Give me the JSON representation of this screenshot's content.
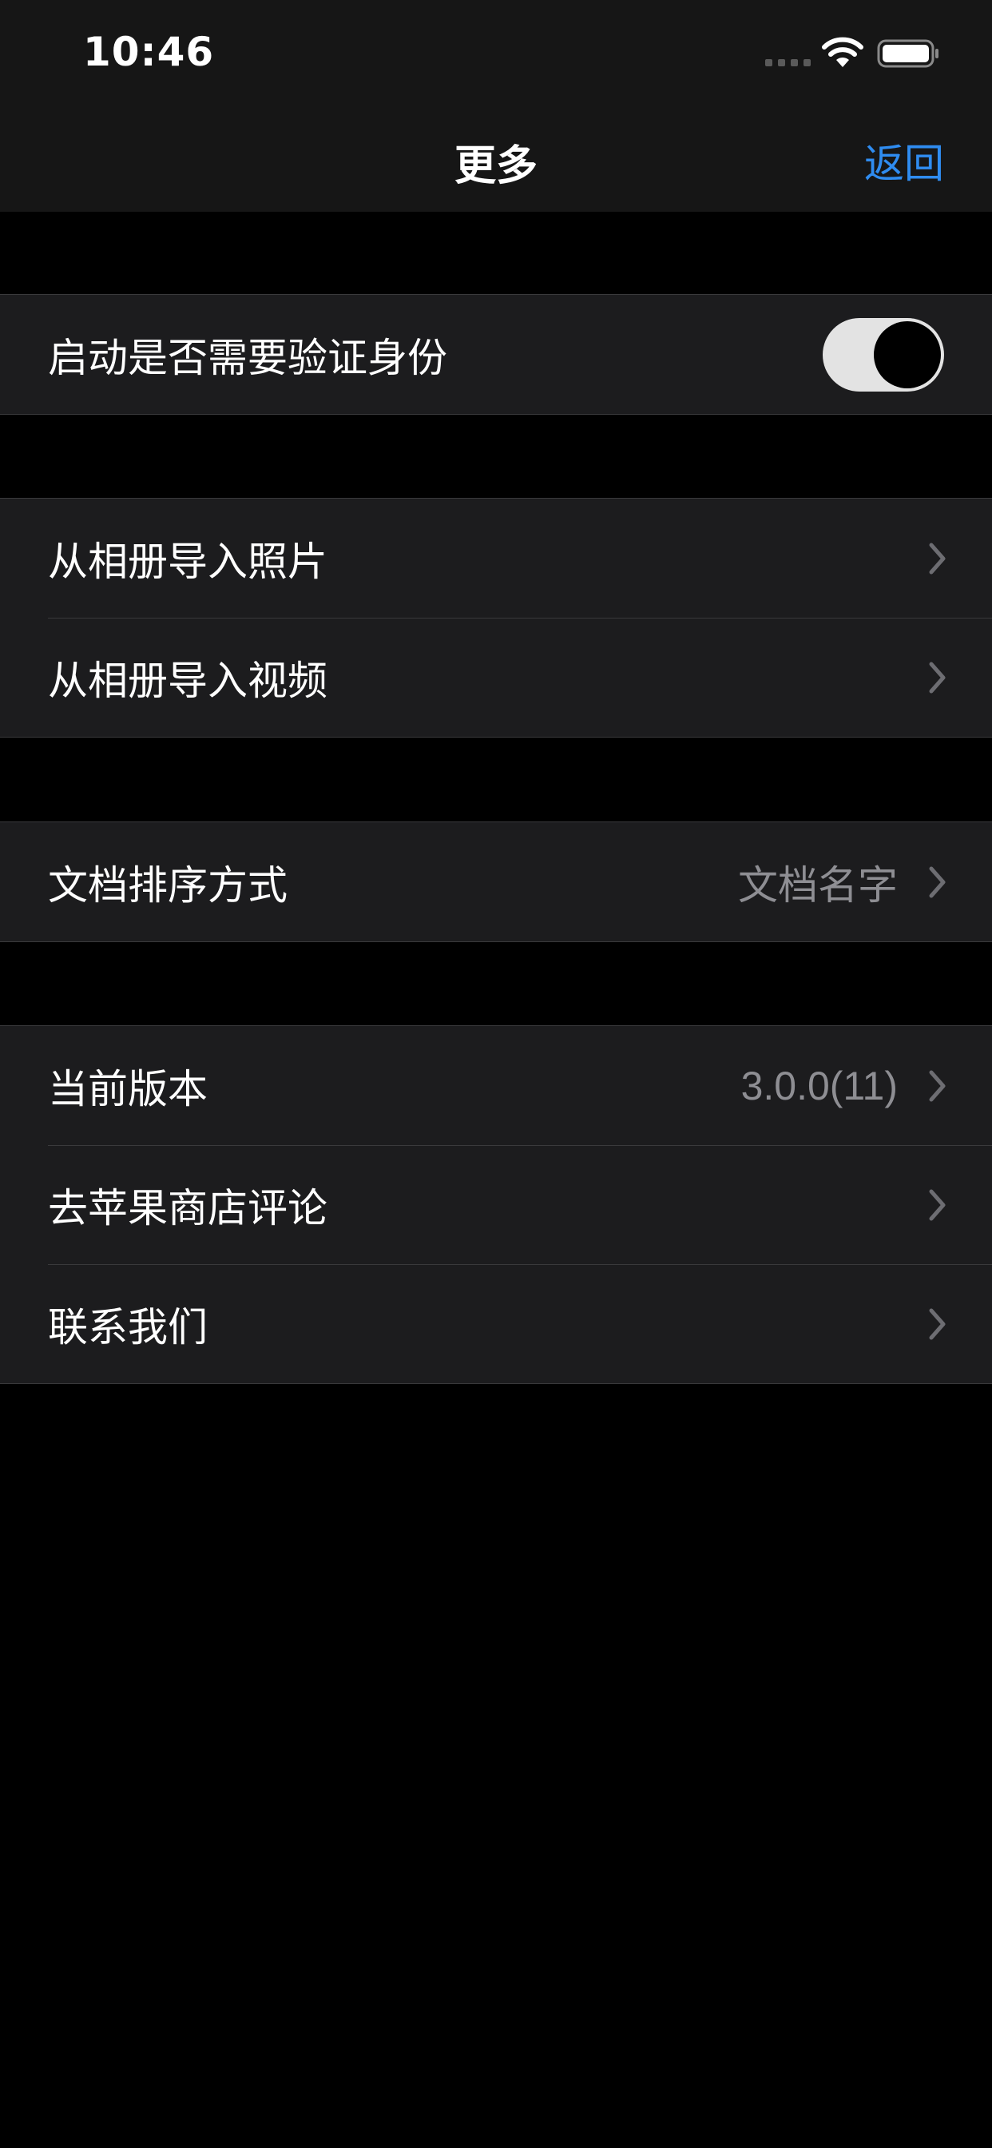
{
  "status_bar": {
    "time": "10:46",
    "icons": [
      "cellular-signal-icon",
      "wifi-icon",
      "battery-icon"
    ]
  },
  "nav": {
    "title": "更多",
    "back_label": "返回"
  },
  "colors": {
    "background": "#000000",
    "bar_background": "#161616",
    "cell_background": "#1c1c1e",
    "separator": "#3a3a3c",
    "accent": "#2f8cf0",
    "secondary_text": "#8e8e93"
  },
  "sections": [
    {
      "rows": [
        {
          "label": "启动是否需要验证身份",
          "accessory": "switch",
          "switch_on": true
        }
      ]
    },
    {
      "rows": [
        {
          "label": "从相册导入照片",
          "accessory": "chevron-right-icon"
        },
        {
          "label": "从相册导入视频",
          "accessory": "chevron-right-icon"
        }
      ]
    },
    {
      "rows": [
        {
          "label": "文档排序方式",
          "value": "文档名字",
          "accessory": "chevron-right-icon"
        }
      ]
    },
    {
      "rows": [
        {
          "label": "当前版本",
          "value": "3.0.0(11)",
          "accessory": "chevron-right-icon"
        },
        {
          "label": "去苹果商店评论",
          "accessory": "chevron-right-icon"
        },
        {
          "label": "联系我们",
          "accessory": "chevron-right-icon"
        }
      ]
    }
  ]
}
